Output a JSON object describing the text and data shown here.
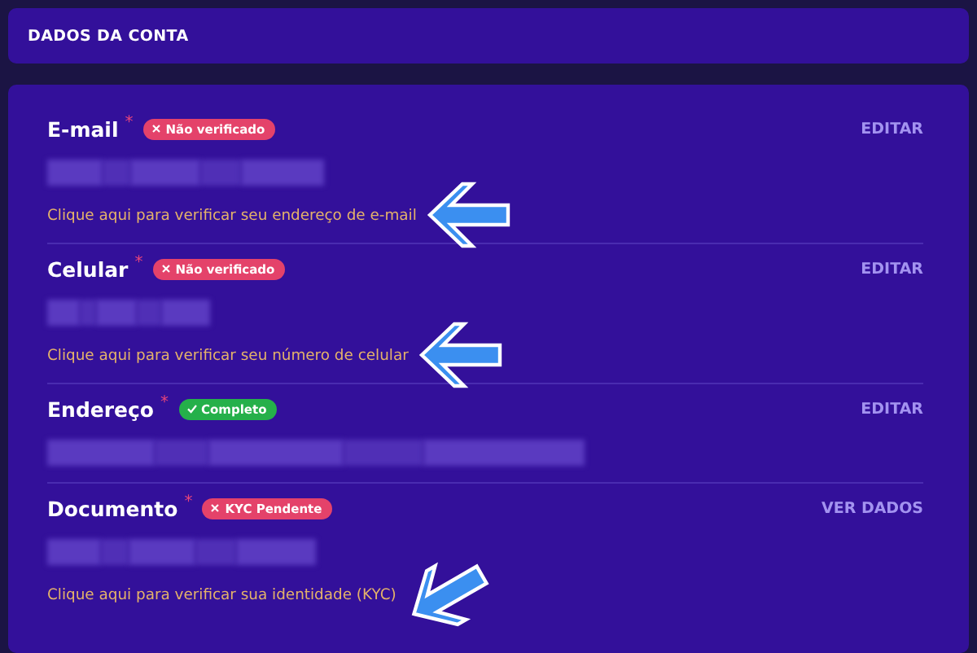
{
  "header": {
    "title": "DADOS DA CONTA"
  },
  "fields": [
    {
      "label": "E-mail",
      "required": "*",
      "badge": {
        "kind": "error",
        "text": "Não verificado"
      },
      "action": "EDITAR",
      "value_redacted": true,
      "link": "Clique aqui para verificar seu endereço de e-mail",
      "arrow": {
        "kind": "left"
      }
    },
    {
      "label": "Celular",
      "required": "*",
      "badge": {
        "kind": "error",
        "text": "Não verificado"
      },
      "action": "EDITAR",
      "value_redacted": true,
      "link": "Clique aqui para verificar seu número de celular",
      "arrow": {
        "kind": "left"
      }
    },
    {
      "label": "Endereço",
      "required": "*",
      "badge": {
        "kind": "ok",
        "text": "Completo"
      },
      "action": "EDITAR",
      "value_redacted": true
    },
    {
      "label": "Documento",
      "required": "*",
      "badge": {
        "kind": "error",
        "text": "KYC Pendente"
      },
      "action": "VER DADOS",
      "value_redacted": true,
      "link": "Clique aqui para verificar sua identidade (KYC)",
      "arrow": {
        "kind": "diagonal"
      }
    }
  ]
}
